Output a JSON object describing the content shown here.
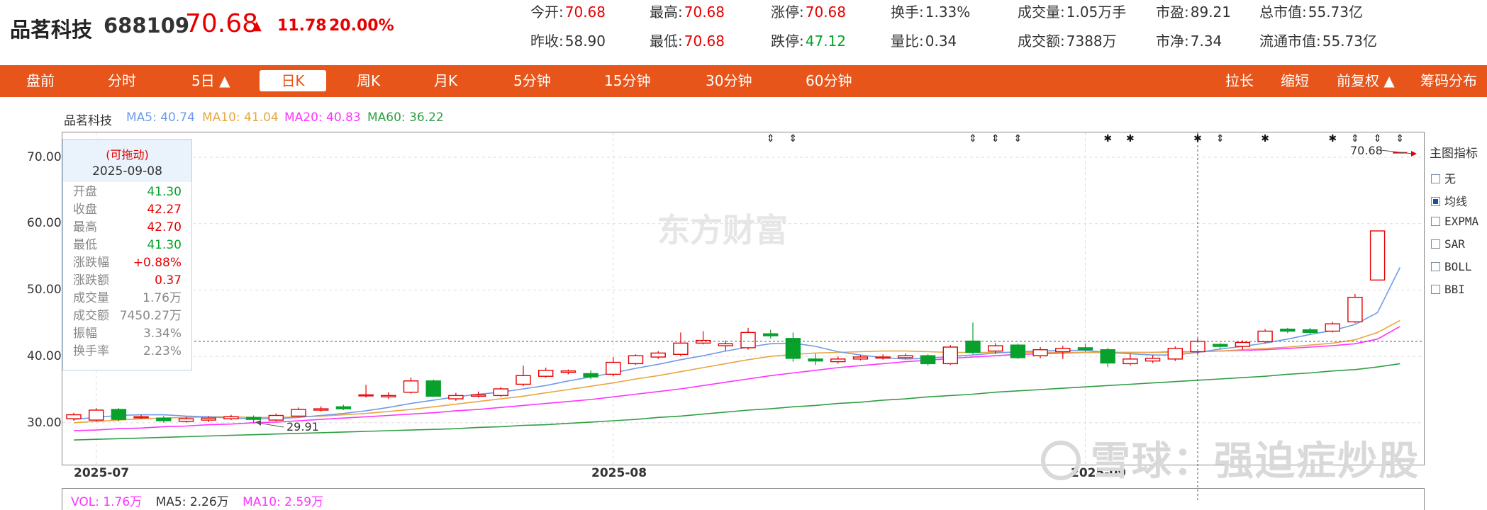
{
  "stock": {
    "name": "品茗科技",
    "code": "688109",
    "price": "70.68",
    "arrow": "▲",
    "change": "11.78",
    "change_pct": "20.00%"
  },
  "stats": [
    {
      "label": "今开:",
      "value": "70.68",
      "color": "red"
    },
    {
      "label": "最高:",
      "value": "70.68",
      "color": "red"
    },
    {
      "label": "涨停:",
      "value": "70.68",
      "color": "red"
    },
    {
      "label": "换手:",
      "value": "1.33%",
      "color": "normal"
    },
    {
      "label": "成交量:",
      "value": "1.05万手",
      "color": "normal"
    },
    {
      "label": "市盈:",
      "value": "89.21",
      "color": "normal"
    },
    {
      "label": "总市值:",
      "value": "55.73亿",
      "color": "normal"
    },
    {
      "label": "昨收:",
      "value": "58.90",
      "color": "normal"
    },
    {
      "label": "最低:",
      "value": "70.68",
      "color": "red"
    },
    {
      "label": "跌停:",
      "value": "47.12",
      "color": "green"
    },
    {
      "label": "量比:",
      "value": "0.34",
      "color": "normal"
    },
    {
      "label": "成交额:",
      "value": "7388万",
      "color": "normal"
    },
    {
      "label": "市净:",
      "value": "7.34",
      "color": "normal"
    },
    {
      "label": "流通市值:",
      "value": "55.73亿",
      "color": "normal"
    }
  ],
  "toolbar": {
    "tabs": [
      "盘前",
      "分时",
      "5日 ▲",
      "日K",
      "周K",
      "月K",
      "5分钟",
      "15分钟",
      "30分钟",
      "60分钟"
    ],
    "active": "日K",
    "right": [
      "拉长",
      "缩短",
      "前复权 ▲",
      "筹码分布"
    ]
  },
  "legend": {
    "name": "品茗科技",
    "ma5": "MA5: 40.74",
    "ma10": "MA10: 41.04",
    "ma20": "MA20: 40.83",
    "ma60": "MA60: 36.22"
  },
  "colors": {
    "accent": "#e8551b",
    "up": "#e60000",
    "down": "#07a12c",
    "ma5": "#6f9bea",
    "ma10": "#e8a640",
    "ma20": "#ff33ff",
    "ma60": "#2f9e44"
  },
  "tooltip": {
    "drag": "(可拖动)",
    "date": "2025-09-08",
    "rows": [
      {
        "k": "开盘",
        "v": "41.30",
        "c": "green"
      },
      {
        "k": "收盘",
        "v": "42.27",
        "c": "red"
      },
      {
        "k": "最高",
        "v": "42.70",
        "c": "red"
      },
      {
        "k": "最低",
        "v": "41.30",
        "c": "green"
      },
      {
        "k": "涨跌幅",
        "v": "+0.88%",
        "c": "red"
      },
      {
        "k": "涨跌额",
        "v": "0.37",
        "c": "red"
      },
      {
        "k": "成交量",
        "v": "1.76万",
        "c": "gray"
      },
      {
        "k": "成交额",
        "v": "7450.27万",
        "c": "gray"
      },
      {
        "k": "振幅",
        "v": "3.34%",
        "c": "gray"
      },
      {
        "k": "换手率",
        "v": "2.23%",
        "c": "gray"
      }
    ]
  },
  "side_panel": {
    "title": "主图指标",
    "options": [
      {
        "label": "无",
        "checked": false
      },
      {
        "label": "均线",
        "checked": true
      },
      {
        "label": "EXPMA",
        "checked": false
      },
      {
        "label": "SAR",
        "checked": false
      },
      {
        "label": "BOLL",
        "checked": false
      },
      {
        "label": "BBI",
        "checked": false
      }
    ]
  },
  "watermark": "东方财富",
  "xueqiu_watermark": "雪球：强迫症炒股",
  "annotations": {
    "max_label": "70.68",
    "min_label": "29.91"
  },
  "volume_legend": {
    "vol": "VOL: 1.76万",
    "ma5": "MA5: 2.26万",
    "ma10": "MA10: 2.59万"
  },
  "chart_data": {
    "type": "candlestick",
    "y_ticks": [
      "70.00",
      "60.00",
      "50.00",
      "40.00",
      "30.00"
    ],
    "ylim": [
      26.5,
      74.5
    ],
    "x_ticks": [
      "2025-07",
      "2025-08",
      "2025-09"
    ],
    "x_tick_index": [
      1,
      24,
      45
    ],
    "candles": [
      [
        30.6,
        31.2,
        31.5,
        30.3
      ],
      [
        30.4,
        31.9,
        32.2,
        30.2
      ],
      [
        32.0,
        30.5,
        32.2,
        30.2
      ],
      [
        30.8,
        30.9,
        31.2,
        30.6
      ],
      [
        30.7,
        30.3,
        31.0,
        30.0
      ],
      [
        30.2,
        30.6,
        30.9,
        30.0
      ],
      [
        30.4,
        30.7,
        31.0,
        30.1
      ],
      [
        30.6,
        30.9,
        31.2,
        30.4
      ],
      [
        30.8,
        30.5,
        31.1,
        29.91
      ],
      [
        30.4,
        31.1,
        31.4,
        30.2
      ],
      [
        31.0,
        32.0,
        32.3,
        30.9
      ],
      [
        31.9,
        32.1,
        32.5,
        31.7
      ],
      [
        32.4,
        32.1,
        32.7,
        31.9
      ],
      [
        34.1,
        34.2,
        35.7,
        33.8
      ],
      [
        33.9,
        34.1,
        34.6,
        33.6
      ],
      [
        34.6,
        36.3,
        36.8,
        34.4
      ],
      [
        36.3,
        34.0,
        36.5,
        33.9
      ],
      [
        33.6,
        34.1,
        34.5,
        33.3
      ],
      [
        34.0,
        34.2,
        34.7,
        33.8
      ],
      [
        34.1,
        35.1,
        35.4,
        33.9
      ],
      [
        35.8,
        37.1,
        38.6,
        35.5
      ],
      [
        37.0,
        37.9,
        38.3,
        36.8
      ],
      [
        37.6,
        37.8,
        38.0,
        37.3
      ],
      [
        37.4,
        36.9,
        37.9,
        36.6
      ],
      [
        37.3,
        39.1,
        39.9,
        37.0
      ],
      [
        38.9,
        40.1,
        40.3,
        38.7
      ],
      [
        39.9,
        40.5,
        40.8,
        39.6
      ],
      [
        40.3,
        42.0,
        43.6,
        40.0
      ],
      [
        42.0,
        42.4,
        43.8,
        41.8
      ],
      [
        41.6,
        41.9,
        42.4,
        40.8
      ],
      [
        41.3,
        43.6,
        44.3,
        41.0
      ],
      [
        43.4,
        43.1,
        44.0,
        42.7
      ],
      [
        42.7,
        39.7,
        43.6,
        39.2
      ],
      [
        39.6,
        39.3,
        40.4,
        38.7
      ],
      [
        39.2,
        39.6,
        40.0,
        38.9
      ],
      [
        39.6,
        39.9,
        40.2,
        39.4
      ],
      [
        39.8,
        39.9,
        40.3,
        39.5
      ],
      [
        39.8,
        40.1,
        40.4,
        39.6
      ],
      [
        40.1,
        38.9,
        40.3,
        38.6
      ],
      [
        38.9,
        41.4,
        41.7,
        38.7
      ],
      [
        42.3,
        40.6,
        45.1,
        40.3
      ],
      [
        40.8,
        41.6,
        42.0,
        40.4
      ],
      [
        41.7,
        39.8,
        41.9,
        39.6
      ],
      [
        40.1,
        41.0,
        41.4,
        39.7
      ],
      [
        40.7,
        41.2,
        41.6,
        39.6
      ],
      [
        41.3,
        41.0,
        41.9,
        40.7
      ],
      [
        41.0,
        39.0,
        41.3,
        38.4
      ],
      [
        38.9,
        39.6,
        40.4,
        38.6
      ],
      [
        39.3,
        39.7,
        40.2,
        39.0
      ],
      [
        39.6,
        41.2,
        41.5,
        39.3
      ],
      [
        40.7,
        42.27,
        42.7,
        40.3
      ],
      [
        41.8,
        41.5,
        42.0,
        41.2
      ],
      [
        41.5,
        42.1,
        42.4,
        41.0
      ],
      [
        42.2,
        43.8,
        44.1,
        42.0
      ],
      [
        44.1,
        43.8,
        44.3,
        43.5
      ],
      [
        44.0,
        43.6,
        44.3,
        43.3
      ],
      [
        43.8,
        44.9,
        45.2,
        43.6
      ],
      [
        45.2,
        48.9,
        49.4,
        45.0
      ],
      [
        51.5,
        58.9,
        58.9,
        51.5
      ],
      [
        70.68,
        70.68,
        70.68,
        70.68
      ]
    ],
    "ma5": [
      30.5,
      30.8,
      31.1,
      31.2,
      31.2,
      31.0,
      30.9,
      30.7,
      30.6,
      30.6,
      30.8,
      31.1,
      31.4,
      31.8,
      32.3,
      32.9,
      33.4,
      33.9,
      34.3,
      34.6,
      35.1,
      35.6,
      36.3,
      36.9,
      37.5,
      38.2,
      38.8,
      39.5,
      40.1,
      40.8,
      41.4,
      41.9,
      42.0,
      41.5,
      40.7,
      40.2,
      39.8,
      39.6,
      39.7,
      40.0,
      40.2,
      40.5,
      40.7,
      40.8,
      40.9,
      40.9,
      40.6,
      40.4,
      40.2,
      40.2,
      40.6,
      41.1,
      41.5,
      42.0,
      42.6,
      43.3,
      43.9,
      44.8,
      46.6,
      53.4
    ],
    "ma10": [
      30.0,
      30.2,
      30.4,
      30.6,
      30.7,
      30.8,
      30.9,
      30.9,
      30.8,
      30.8,
      30.9,
      31.0,
      31.2,
      31.4,
      31.7,
      32.0,
      32.4,
      32.8,
      33.2,
      33.6,
      34.0,
      34.5,
      35.0,
      35.5,
      36.0,
      36.6,
      37.1,
      37.7,
      38.3,
      38.9,
      39.5,
      40.0,
      40.3,
      40.5,
      40.6,
      40.7,
      40.8,
      40.8,
      40.7,
      40.6,
      40.6,
      40.6,
      40.6,
      40.6,
      40.6,
      40.6,
      40.6,
      40.6,
      40.6,
      40.6,
      40.7,
      40.8,
      41.0,
      41.2,
      41.4,
      41.7,
      42.0,
      42.5,
      43.6,
      45.4
    ],
    "ma20": [
      28.8,
      28.9,
      29.1,
      29.2,
      29.4,
      29.5,
      29.7,
      29.8,
      30.0,
      30.1,
      30.3,
      30.5,
      30.7,
      30.9,
      31.1,
      31.3,
      31.5,
      31.8,
      32.0,
      32.3,
      32.6,
      32.9,
      33.2,
      33.5,
      33.9,
      34.3,
      34.7,
      35.1,
      35.6,
      36.1,
      36.6,
      37.1,
      37.5,
      37.9,
      38.3,
      38.6,
      38.9,
      39.2,
      39.4,
      39.7,
      39.9,
      40.1,
      40.3,
      40.4,
      40.5,
      40.6,
      40.6,
      40.6,
      40.6,
      40.7,
      40.7,
      40.8,
      40.9,
      41.0,
      41.2,
      41.4,
      41.6,
      41.9,
      42.6,
      44.5
    ],
    "ma60": [
      27.4,
      27.5,
      27.6,
      27.7,
      27.8,
      27.9,
      28.0,
      28.1,
      28.2,
      28.3,
      28.4,
      28.5,
      28.6,
      28.7,
      28.8,
      28.9,
      29.0,
      29.1,
      29.3,
      29.4,
      29.6,
      29.7,
      29.9,
      30.1,
      30.3,
      30.5,
      30.8,
      31.0,
      31.3,
      31.6,
      31.9,
      32.1,
      32.4,
      32.6,
      32.9,
      33.1,
      33.4,
      33.6,
      33.9,
      34.1,
      34.3,
      34.6,
      34.8,
      35.0,
      35.2,
      35.4,
      35.6,
      35.8,
      36.0,
      36.2,
      36.4,
      36.6,
      36.8,
      37.0,
      37.3,
      37.5,
      37.8,
      38.0,
      38.4,
      38.9
    ],
    "markers": [
      {
        "i": 31,
        "c": "arrow"
      },
      {
        "i": 32,
        "c": "arrow"
      },
      {
        "i": 40,
        "c": "arrow"
      },
      {
        "i": 41,
        "c": "arrow"
      },
      {
        "i": 42,
        "c": "arrow"
      },
      {
        "i": 46,
        "c": "star"
      },
      {
        "i": 47,
        "c": "star"
      },
      {
        "i": 50,
        "c": "star"
      },
      {
        "i": 51,
        "c": "arrow"
      },
      {
        "i": 53,
        "c": "star"
      },
      {
        "i": 56,
        "c": "star"
      },
      {
        "i": 57,
        "c": "arrow"
      },
      {
        "i": 58,
        "c": "arrow"
      },
      {
        "i": 59,
        "c": "arrow"
      }
    ]
  }
}
